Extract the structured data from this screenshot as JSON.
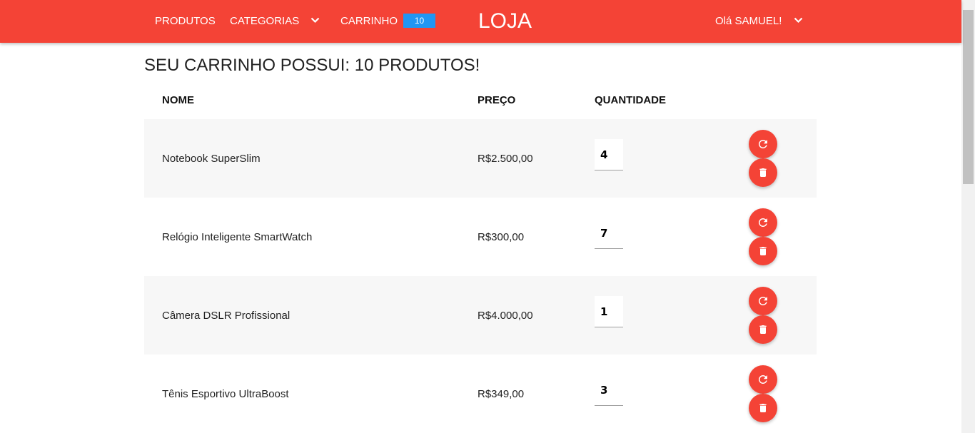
{
  "navbar": {
    "products_label": "PRODUTOS",
    "categories_label": "CATEGORIAS",
    "cart_label": "CARRINHO",
    "cart_count": "10",
    "brand": "LOJA",
    "greeting": "Olá SAMUEL!"
  },
  "cart": {
    "title": "SEU CARRINHO POSSUI: 10 PRODUTOS!",
    "columns": {
      "name": "NOME",
      "price": "PREÇO",
      "quantity": "QUANTIDADE"
    },
    "items": [
      {
        "name": "Notebook SuperSlim",
        "price": "R$2.500,00",
        "quantity": "4"
      },
      {
        "name": "Relógio Inteligente SmartWatch",
        "price": "R$300,00",
        "quantity": "7"
      },
      {
        "name": "Câmera DSLR Profissional",
        "price": "R$4.000,00",
        "quantity": "1"
      },
      {
        "name": "Tênis Esportivo UltraBoost",
        "price": "R$349,00",
        "quantity": "3"
      }
    ]
  },
  "colors": {
    "primary": "#f44336",
    "badge": "#2196f3",
    "row_stripe": "#f7f7f7"
  },
  "icons": {
    "refresh": "refresh-icon",
    "delete": "trash-icon",
    "dropdown": "chevron-down-icon"
  }
}
